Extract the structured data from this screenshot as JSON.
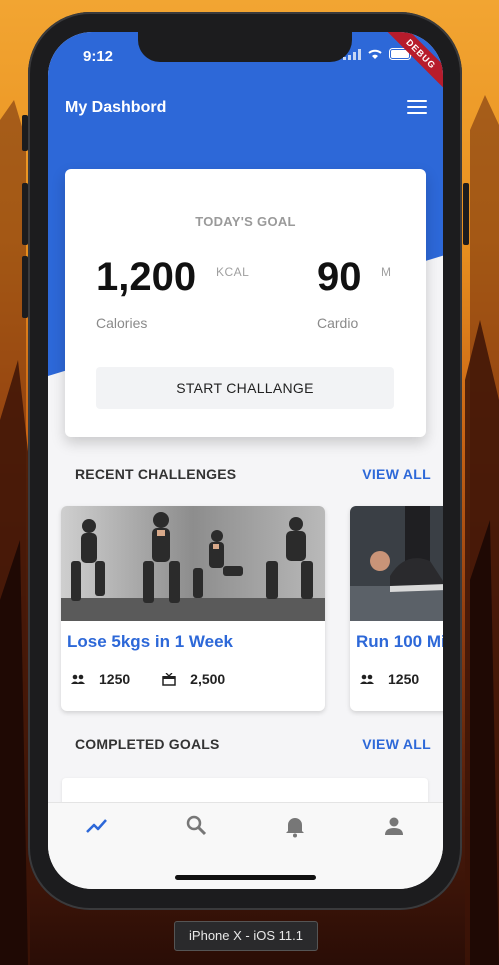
{
  "status_bar": {
    "time": "9:12",
    "debug_banner": "DEBUG"
  },
  "app_bar": {
    "title": "My Dashbord",
    "menu_icon": "menu-icon"
  },
  "goal_card": {
    "title": "TODAY'S GOAL",
    "calories": {
      "value": "1,200",
      "unit": "KCAL",
      "label": "Calories"
    },
    "cardio": {
      "value": "90",
      "unit": "M",
      "label": "Cardio"
    },
    "button_label": "START CHALLANGE"
  },
  "recent_challenges": {
    "heading": "RECENT CHALLENGES",
    "view_all": "VIEW ALL",
    "cards": [
      {
        "title": "Lose 5kgs in 1 Week",
        "participants": "1250",
        "reward": "2,500"
      },
      {
        "title": "Run 100 Mi",
        "participants": "1250"
      }
    ]
  },
  "completed_goals": {
    "heading": "COMPLETED GOALS",
    "view_all": "VIEW ALL"
  },
  "bottom_nav": {
    "items": [
      "trending-icon",
      "search-icon",
      "bell-icon",
      "person-icon"
    ],
    "active_color": "#2d68d8",
    "inactive_color": "#777777"
  },
  "device_label": "iPhone X - iOS 11.1",
  "colors": {
    "primary": "#2d68d8",
    "debug": "#b71c2c"
  }
}
